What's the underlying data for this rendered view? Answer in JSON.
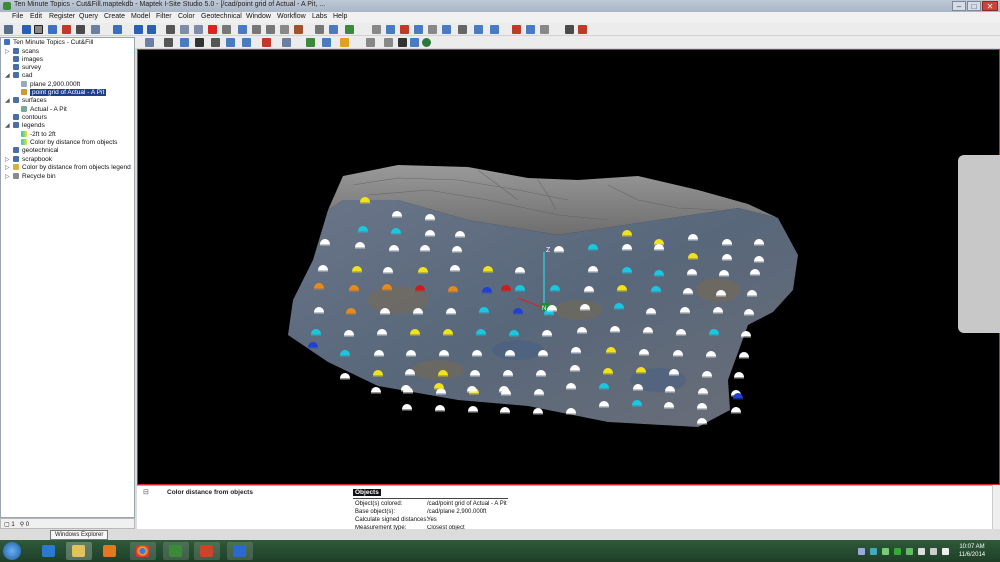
{
  "window": {
    "title": "Ten Minute Topics - Cut&Fill.maptekdb - Maptek I-Site Studio 5.0 - [/cad/point grid of Actual - A Pit, ...",
    "minimize": "–",
    "maximize": "□",
    "close": "✕"
  },
  "menu": [
    "File",
    "Edit",
    "Register",
    "Query",
    "Create",
    "Model",
    "Filter",
    "Color",
    "Geotechnical",
    "Window",
    "Workflow",
    "Labs",
    "Help"
  ],
  "tree": {
    "root": "Ten Minute Topics - Cut&Fill",
    "items": [
      {
        "label": "scans",
        "level": 1
      },
      {
        "label": "images",
        "level": 1
      },
      {
        "label": "survey",
        "level": 1
      },
      {
        "label": "cad",
        "level": 1
      },
      {
        "label": "plane 2,900.000ft",
        "level": 2
      },
      {
        "label": "point grid of Actual - A Pit",
        "level": 2,
        "selected": true
      },
      {
        "label": "surfaces",
        "level": 1
      },
      {
        "label": "Actual - A Pit",
        "level": 2
      },
      {
        "label": "contours",
        "level": 1
      },
      {
        "label": "legends",
        "level": 1
      },
      {
        "label": "-2ft to 2ft",
        "level": 2
      },
      {
        "label": "Color by distance from objects",
        "level": 2
      },
      {
        "label": "geotechnical",
        "level": 1
      },
      {
        "label": "scrapbook",
        "level": 1
      },
      {
        "label": "Color by distance from objects legend",
        "level": 1
      },
      {
        "label": "Recycle bin",
        "level": 1
      }
    ],
    "status_a": "1",
    "status_b": "0"
  },
  "viewport": {
    "axis_z": "Z",
    "axis_n": "N",
    "colors": {
      "white": "#ffffff",
      "yellow": "#f2e21c",
      "cyan": "#19c8e0",
      "blue": "#1f3fd6",
      "orange": "#e88a1a",
      "red": "#d11b1b"
    }
  },
  "properties": {
    "collapse": "⊟",
    "title": "Color distance from objects",
    "tab": "Objects",
    "rows": [
      {
        "label": "Object(s) colored:",
        "value": "/cad/point grid of Actual - A Pit"
      },
      {
        "label": "Base object(s):",
        "value": "/cad/plane 2,900.000ft"
      },
      {
        "label": "Calculate signed distances:",
        "value": "Yes"
      },
      {
        "label": "Measurement type:",
        "value": "Closest object"
      }
    ]
  },
  "taskbar": {
    "tooltip": "Windows Explorer",
    "time": "10:07 AM",
    "date": "11/6/2014"
  }
}
